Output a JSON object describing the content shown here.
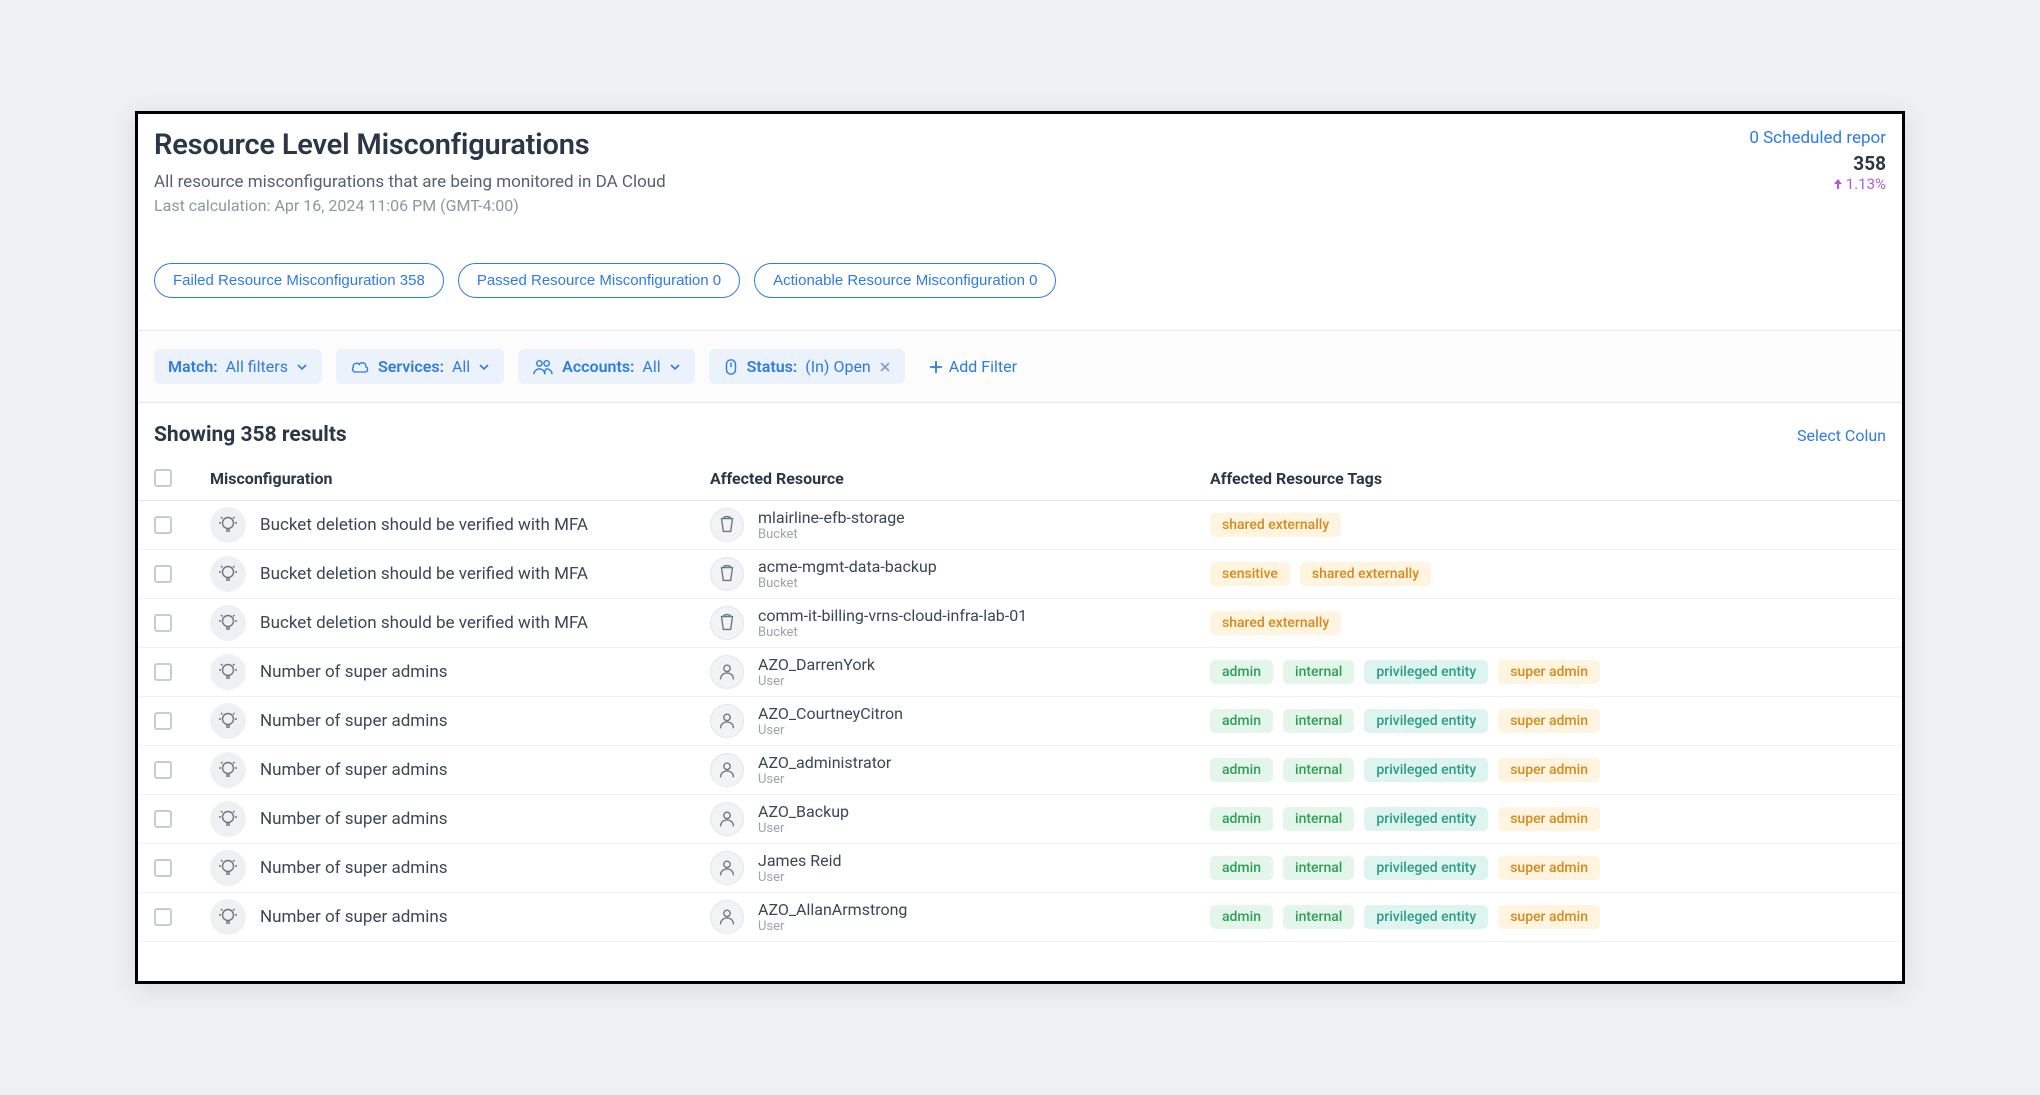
{
  "header": {
    "title": "Resource Level Misconfigurations",
    "scheduled_reports": "0 Scheduled repor",
    "subtitle": "All resource misconfigurations that are being monitored in DA Cloud",
    "last_calc": "Last calculation: Apr 16, 2024 11:06 PM (GMT-4:00)",
    "metric_count": "358",
    "metric_pct": "1.13%"
  },
  "pills": {
    "failed": "Failed Resource Misconfiguration 358",
    "passed": "Passed Resource Misconfiguration 0",
    "actionable": "Actionable Resource Misconfiguration 0"
  },
  "filters": {
    "match_label": "Match:",
    "match_val": "All filters",
    "services_label": "Services:",
    "services_val": "All",
    "accounts_label": "Accounts:",
    "accounts_val": "All",
    "status_label": "Status:",
    "status_val": "(In) Open",
    "add_filter": "Add Filter"
  },
  "results": {
    "count_text": "Showing 358 results",
    "select_columns": "Select Colun"
  },
  "columns": {
    "misconfig": "Misconfiguration",
    "resource": "Affected Resource",
    "tags": "Affected Resource Tags"
  },
  "tag_labels": {
    "shared_externally": "shared externally",
    "sensitive": "sensitive",
    "admin": "admin",
    "internal": "internal",
    "privileged_entity": "privileged entity",
    "super_admin": "super admin"
  },
  "rows": [
    {
      "misconfig": "Bucket deletion should be verified with MFA",
      "resource_name": "mlairline-efb-storage",
      "resource_type": "Bucket",
      "resource_icon": "bucket",
      "tags": [
        "shared_externally"
      ]
    },
    {
      "misconfig": "Bucket deletion should be verified with MFA",
      "resource_name": "acme-mgmt-data-backup",
      "resource_type": "Bucket",
      "resource_icon": "bucket",
      "tags": [
        "sensitive",
        "shared_externally"
      ]
    },
    {
      "misconfig": "Bucket deletion should be verified with MFA",
      "resource_name": "comm-it-billing-vrns-cloud-infra-lab-01",
      "resource_type": "Bucket",
      "resource_icon": "bucket",
      "tags": [
        "shared_externally"
      ]
    },
    {
      "misconfig": "Number of super admins",
      "resource_name": "AZO_DarrenYork",
      "resource_type": "User",
      "resource_icon": "user",
      "tags": [
        "admin",
        "internal",
        "privileged_entity",
        "super_admin"
      ]
    },
    {
      "misconfig": "Number of super admins",
      "resource_name": "AZO_CourtneyCitron",
      "resource_type": "User",
      "resource_icon": "user",
      "tags": [
        "admin",
        "internal",
        "privileged_entity",
        "super_admin"
      ]
    },
    {
      "misconfig": "Number of super admins",
      "resource_name": "AZO_administrator",
      "resource_type": "User",
      "resource_icon": "user",
      "tags": [
        "admin",
        "internal",
        "privileged_entity",
        "super_admin"
      ]
    },
    {
      "misconfig": "Number of super admins",
      "resource_name": "AZO_Backup",
      "resource_type": "User",
      "resource_icon": "user",
      "tags": [
        "admin",
        "internal",
        "privileged_entity",
        "super_admin"
      ]
    },
    {
      "misconfig": "Number of super admins",
      "resource_name": "James Reid",
      "resource_type": "User",
      "resource_icon": "user",
      "tags": [
        "admin",
        "internal",
        "privileged_entity",
        "super_admin"
      ]
    },
    {
      "misconfig": "Number of super admins",
      "resource_name": "AZO_AllanArmstrong",
      "resource_type": "User",
      "resource_icon": "user",
      "tags": [
        "admin",
        "internal",
        "privileged_entity",
        "super_admin"
      ]
    }
  ],
  "tag_colors": {
    "shared_externally": "orange",
    "sensitive": "orange",
    "admin": "green",
    "internal": "green",
    "privileged_entity": "teal",
    "super_admin": "orange"
  }
}
